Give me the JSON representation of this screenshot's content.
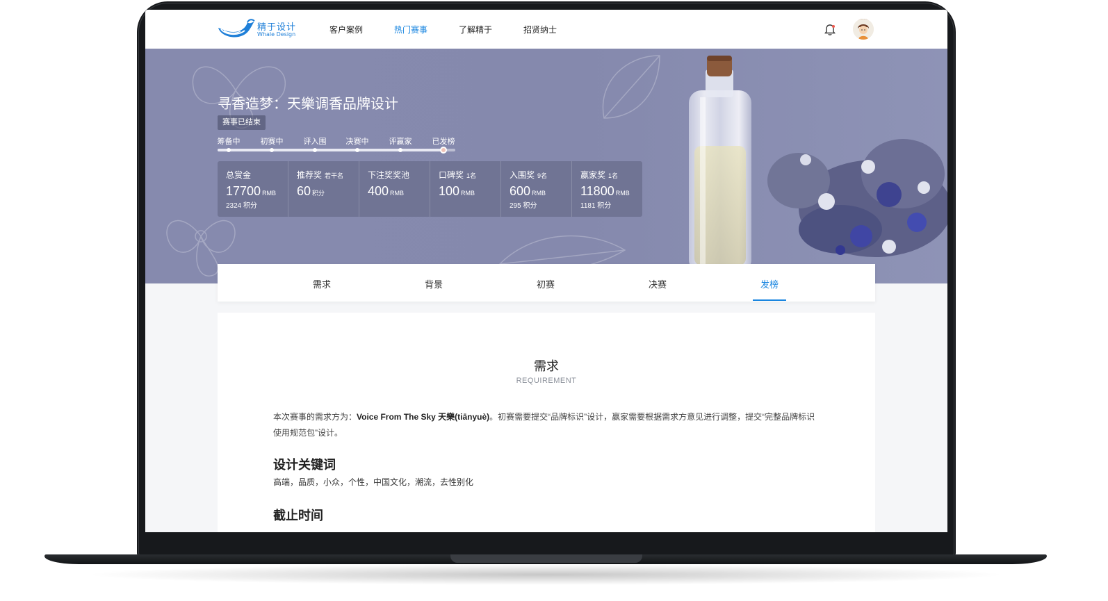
{
  "nav": {
    "logo_cn": "精于设计",
    "logo_en": "Whale Design",
    "items": [
      {
        "label": "客户案例",
        "active": false
      },
      {
        "label": "热门赛事",
        "active": true
      },
      {
        "label": "了解精于",
        "active": false
      },
      {
        "label": "招贤纳士",
        "active": false
      }
    ],
    "bell_icon": "bell-icon",
    "avatar_icon": "user-avatar"
  },
  "banner": {
    "title": "寻香造梦：天樂调香品牌设计",
    "status": "赛事已结束",
    "steps": [
      "筹备中",
      "初赛中",
      "评入围",
      "决赛中",
      "评赢家",
      "已发榜"
    ],
    "current_step": 6,
    "prizes": [
      {
        "label": "总赏金",
        "sub": "",
        "value": "17700",
        "unit": "RMB",
        "points": "2324 积分"
      },
      {
        "label": "推荐奖",
        "sub": "若干名",
        "value": "60",
        "unit": "积分",
        "points": ""
      },
      {
        "label": "下注奖奖池",
        "sub": "",
        "value": "400",
        "unit": "RMB",
        "points": ""
      },
      {
        "label": "口碑奖",
        "sub": "1名",
        "value": "100",
        "unit": "RMB",
        "points": ""
      },
      {
        "label": "入围奖",
        "sub": "9名",
        "value": "600",
        "unit": "RMB",
        "points": "295 积分"
      },
      {
        "label": "赢家奖",
        "sub": "1名",
        "value": "11800",
        "unit": "RMB",
        "points": "1181 积分"
      }
    ]
  },
  "tabs": [
    {
      "label": "需求",
      "active": false
    },
    {
      "label": "背景",
      "active": false
    },
    {
      "label": "初赛",
      "active": false
    },
    {
      "label": "决赛",
      "active": false
    },
    {
      "label": "发榜",
      "active": true
    }
  ],
  "content": {
    "section_title": "需求",
    "section_subtitle": "REQUIREMENT",
    "para_prefix": "本次赛事的需求方为：",
    "para_client": "Voice From The Sky 天樂(tiānyuè)",
    "para_rest": "。初赛需要提交“品牌标识”设计，赢家需要根据需求方意见进行调整，提交“完整品牌标识使用规范包”设计。",
    "keywords_title": "设计关键词",
    "keywords": "高端，品质，小众，个性，中国文化，潮流，去性别化",
    "deadline_title": "截止时间"
  },
  "colors": {
    "accent": "#1a86e0",
    "banner": "#868aae",
    "text": "#222222"
  }
}
